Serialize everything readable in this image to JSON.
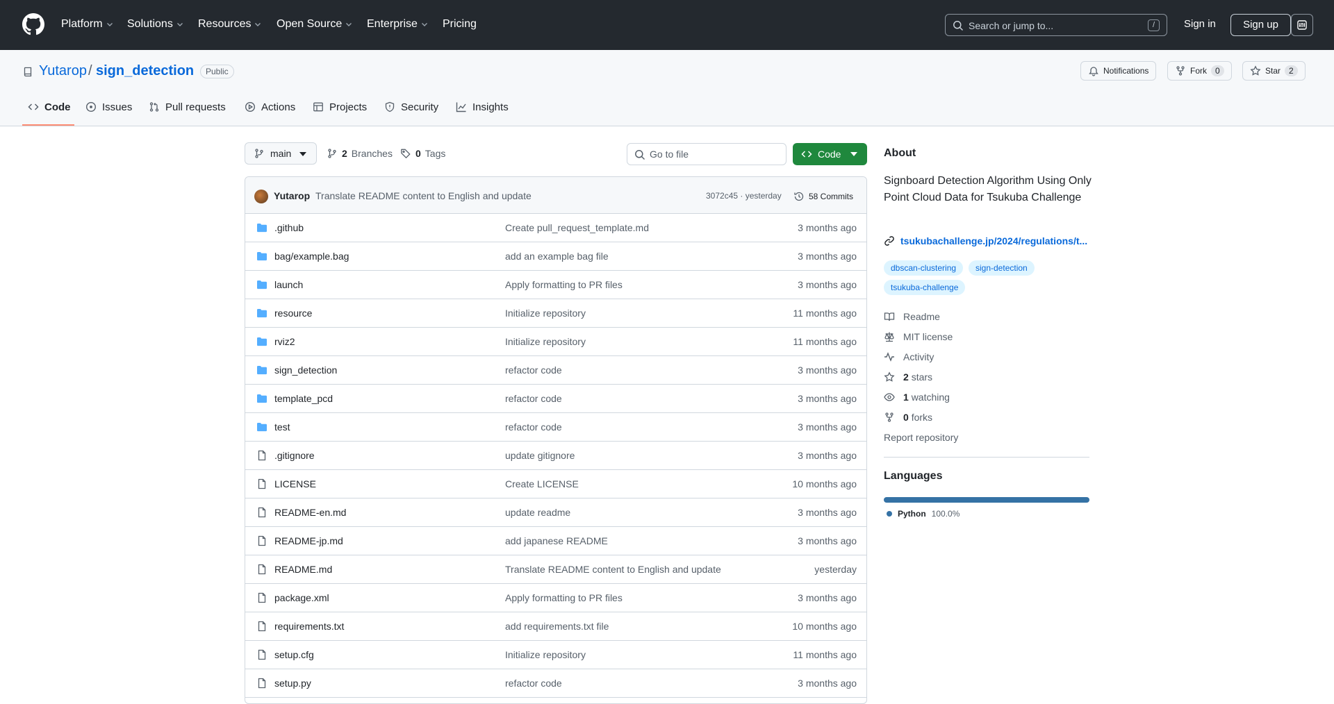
{
  "header": {
    "nav": [
      "Platform",
      "Solutions",
      "Resources",
      "Open Source",
      "Enterprise",
      "Pricing"
    ],
    "search_placeholder": "Search or jump to...",
    "search_shortcut": "/",
    "signin": "Sign in",
    "signup": "Sign up"
  },
  "repo": {
    "owner": "Yutarop",
    "separator": "/",
    "name": "sign_detection",
    "visibility": "Public",
    "notifications": "Notifications",
    "fork_label": "Fork",
    "fork_count": "0",
    "star_label": "Star",
    "star_count": "2"
  },
  "tabs": [
    "Code",
    "Issues",
    "Pull requests",
    "Actions",
    "Projects",
    "Security",
    "Insights"
  ],
  "toolbar": {
    "branch": "main",
    "branches_count": "2",
    "branches_label": "Branches",
    "tags_count": "0",
    "tags_label": "Tags",
    "goto_placeholder": "Go to file",
    "code_button": "Code"
  },
  "commit": {
    "user": "Yutarop",
    "message": "Translate README content to English and update",
    "hash_time": "3072c45 · yesterday",
    "count": "58 Commits"
  },
  "files": [
    {
      "type": "dir",
      "name": ".github",
      "message": "Create pull_request_template.md",
      "time": "3 months ago"
    },
    {
      "type": "dir",
      "name": "bag/example.bag",
      "message": "add an example bag file",
      "time": "3 months ago"
    },
    {
      "type": "dir",
      "name": "launch",
      "message": "Apply formatting to PR files",
      "time": "3 months ago"
    },
    {
      "type": "dir",
      "name": "resource",
      "message": "Initialize repository",
      "time": "11 months ago"
    },
    {
      "type": "dir",
      "name": "rviz2",
      "message": "Initialize repository",
      "time": "11 months ago"
    },
    {
      "type": "dir",
      "name": "sign_detection",
      "message": "refactor code",
      "time": "3 months ago"
    },
    {
      "type": "dir",
      "name": "template_pcd",
      "message": "refactor code",
      "time": "3 months ago"
    },
    {
      "type": "dir",
      "name": "test",
      "message": "refactor code",
      "time": "3 months ago"
    },
    {
      "type": "file",
      "name": ".gitignore",
      "message": "update gitignore",
      "time": "3 months ago"
    },
    {
      "type": "file",
      "name": "LICENSE",
      "message": "Create LICENSE",
      "time": "10 months ago"
    },
    {
      "type": "file",
      "name": "README-en.md",
      "message": "update readme",
      "time": "3 months ago"
    },
    {
      "type": "file",
      "name": "README-jp.md",
      "message": "add japanese README",
      "time": "3 months ago"
    },
    {
      "type": "file",
      "name": "README.md",
      "message": "Translate README content to English and update",
      "time": "yesterday"
    },
    {
      "type": "file",
      "name": "package.xml",
      "message": "Apply formatting to PR files",
      "time": "3 months ago"
    },
    {
      "type": "file",
      "name": "requirements.txt",
      "message": "add requirements.txt file",
      "time": "10 months ago"
    },
    {
      "type": "file",
      "name": "setup.cfg",
      "message": "Initialize repository",
      "time": "11 months ago"
    },
    {
      "type": "file",
      "name": "setup.py",
      "message": "refactor code",
      "time": "3 months ago"
    }
  ],
  "about": {
    "title": "About",
    "description": "Signboard Detection Algorithm Using Only Point Cloud Data for Tsukuba Challenge",
    "link": "tsukubachallenge.jp/2024/regulations/t...",
    "topics": [
      "dbscan-clustering",
      "sign-detection",
      "tsukuba-challenge"
    ],
    "readme": "Readme",
    "license": "MIT license",
    "activity": "Activity",
    "stars_count": "2",
    "stars_label": "stars",
    "watching_count": "1",
    "watching_label": "watching",
    "forks_count": "0",
    "forks_label": "forks",
    "report": "Report repository"
  },
  "languages": {
    "title": "Languages",
    "items": [
      {
        "name": "Python",
        "percent": "100.0%",
        "fraction": 1.0,
        "color": "#3572a5"
      }
    ]
  },
  "colors": {
    "header_bg": "#24292f",
    "link": "#0969da",
    "code_button": "#1f883d",
    "tab_underline": "#fd8c73",
    "folder": "#54aeff"
  }
}
